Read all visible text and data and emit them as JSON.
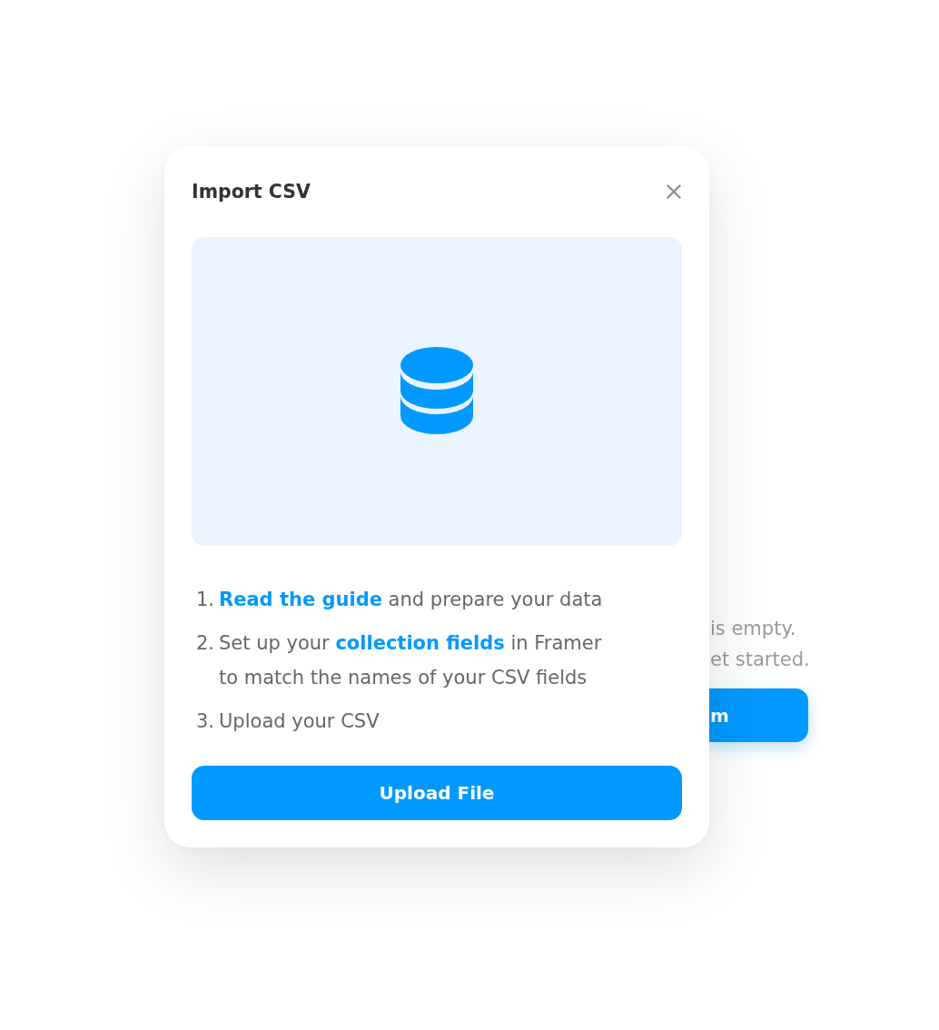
{
  "background": {
    "message_lines": [
      "is empty.",
      "et started."
    ],
    "button": {
      "label": "m"
    }
  },
  "dialog": {
    "title": "Import CSV",
    "steps": [
      {
        "number": "1.",
        "parts": [
          {
            "kind": "link",
            "text": "Read the guide"
          },
          {
            "kind": "text",
            "text": " and prepare your data"
          }
        ]
      },
      {
        "number": "2.",
        "parts": [
          {
            "kind": "text",
            "text": "Set up your "
          },
          {
            "kind": "link",
            "text": "collection fields"
          },
          {
            "kind": "text",
            "text": " in Framer to match the names of your CSV fields"
          }
        ]
      },
      {
        "number": "3.",
        "parts": [
          {
            "kind": "text",
            "text": "Upload your CSV"
          }
        ]
      }
    ],
    "upload_button": {
      "label": "Upload File"
    }
  }
}
